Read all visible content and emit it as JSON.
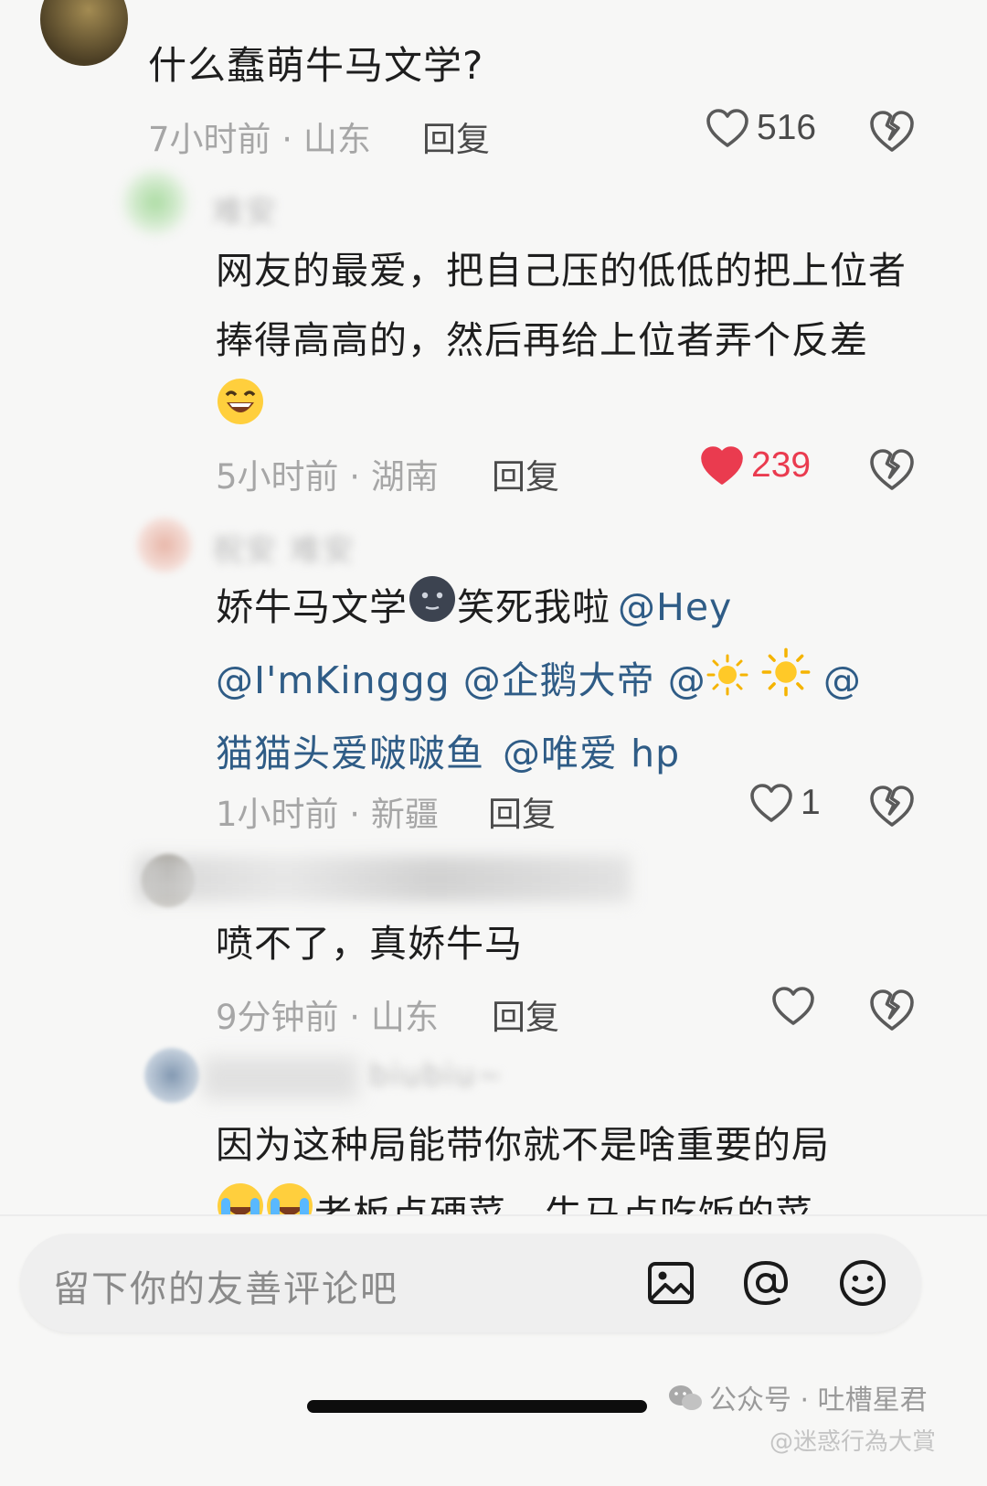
{
  "comments": [
    {
      "text": "什么蠢萌牛马文学?",
      "time": "7小时前 · 山东",
      "reply": "回复",
      "likes": "516",
      "liked": false
    },
    {
      "user": "难安",
      "text": "网友的最爱，把自己压的低低的把上位者捧得高高的，然后再给上位者弄个反差",
      "time": "5小时前 · 湖南",
      "reply": "回复",
      "likes": "239",
      "liked": true
    },
    {
      "user": "祝安 难安",
      "text": "娇牛马文学",
      "text2": "笑死我啦",
      "mentions": [
        "@Hey",
        "@I'mKinggg",
        "@企鹅大帝",
        "@",
        "@",
        "猫猫头爱啵啵鱼",
        "@唯爱 hp"
      ],
      "time": "1小时前 · 新疆",
      "reply": "回复",
      "likes": "1",
      "liked": false
    },
    {
      "text": "喷不了，真娇牛马",
      "time": "9分钟前 · 山东",
      "reply": "回复",
      "likes": "",
      "liked": false
    },
    {
      "user": "biubiu~",
      "text": "因为这种局能带你就不是啥重要的局",
      "text2": "老板点硬菜，牛马点吃饭的菜"
    }
  ],
  "input": {
    "placeholder": "留下你的友善评论吧",
    "icons": [
      "image-icon",
      "at-icon",
      "emoji-icon"
    ]
  },
  "watermark": {
    "line1": "公众号 · 吐槽星君",
    "line2": "@迷惑行為大賞"
  },
  "colors": {
    "accent_red": "#ea3b4f",
    "mention_blue": "#2f5c86",
    "meta_gray": "#a6a6a6"
  }
}
